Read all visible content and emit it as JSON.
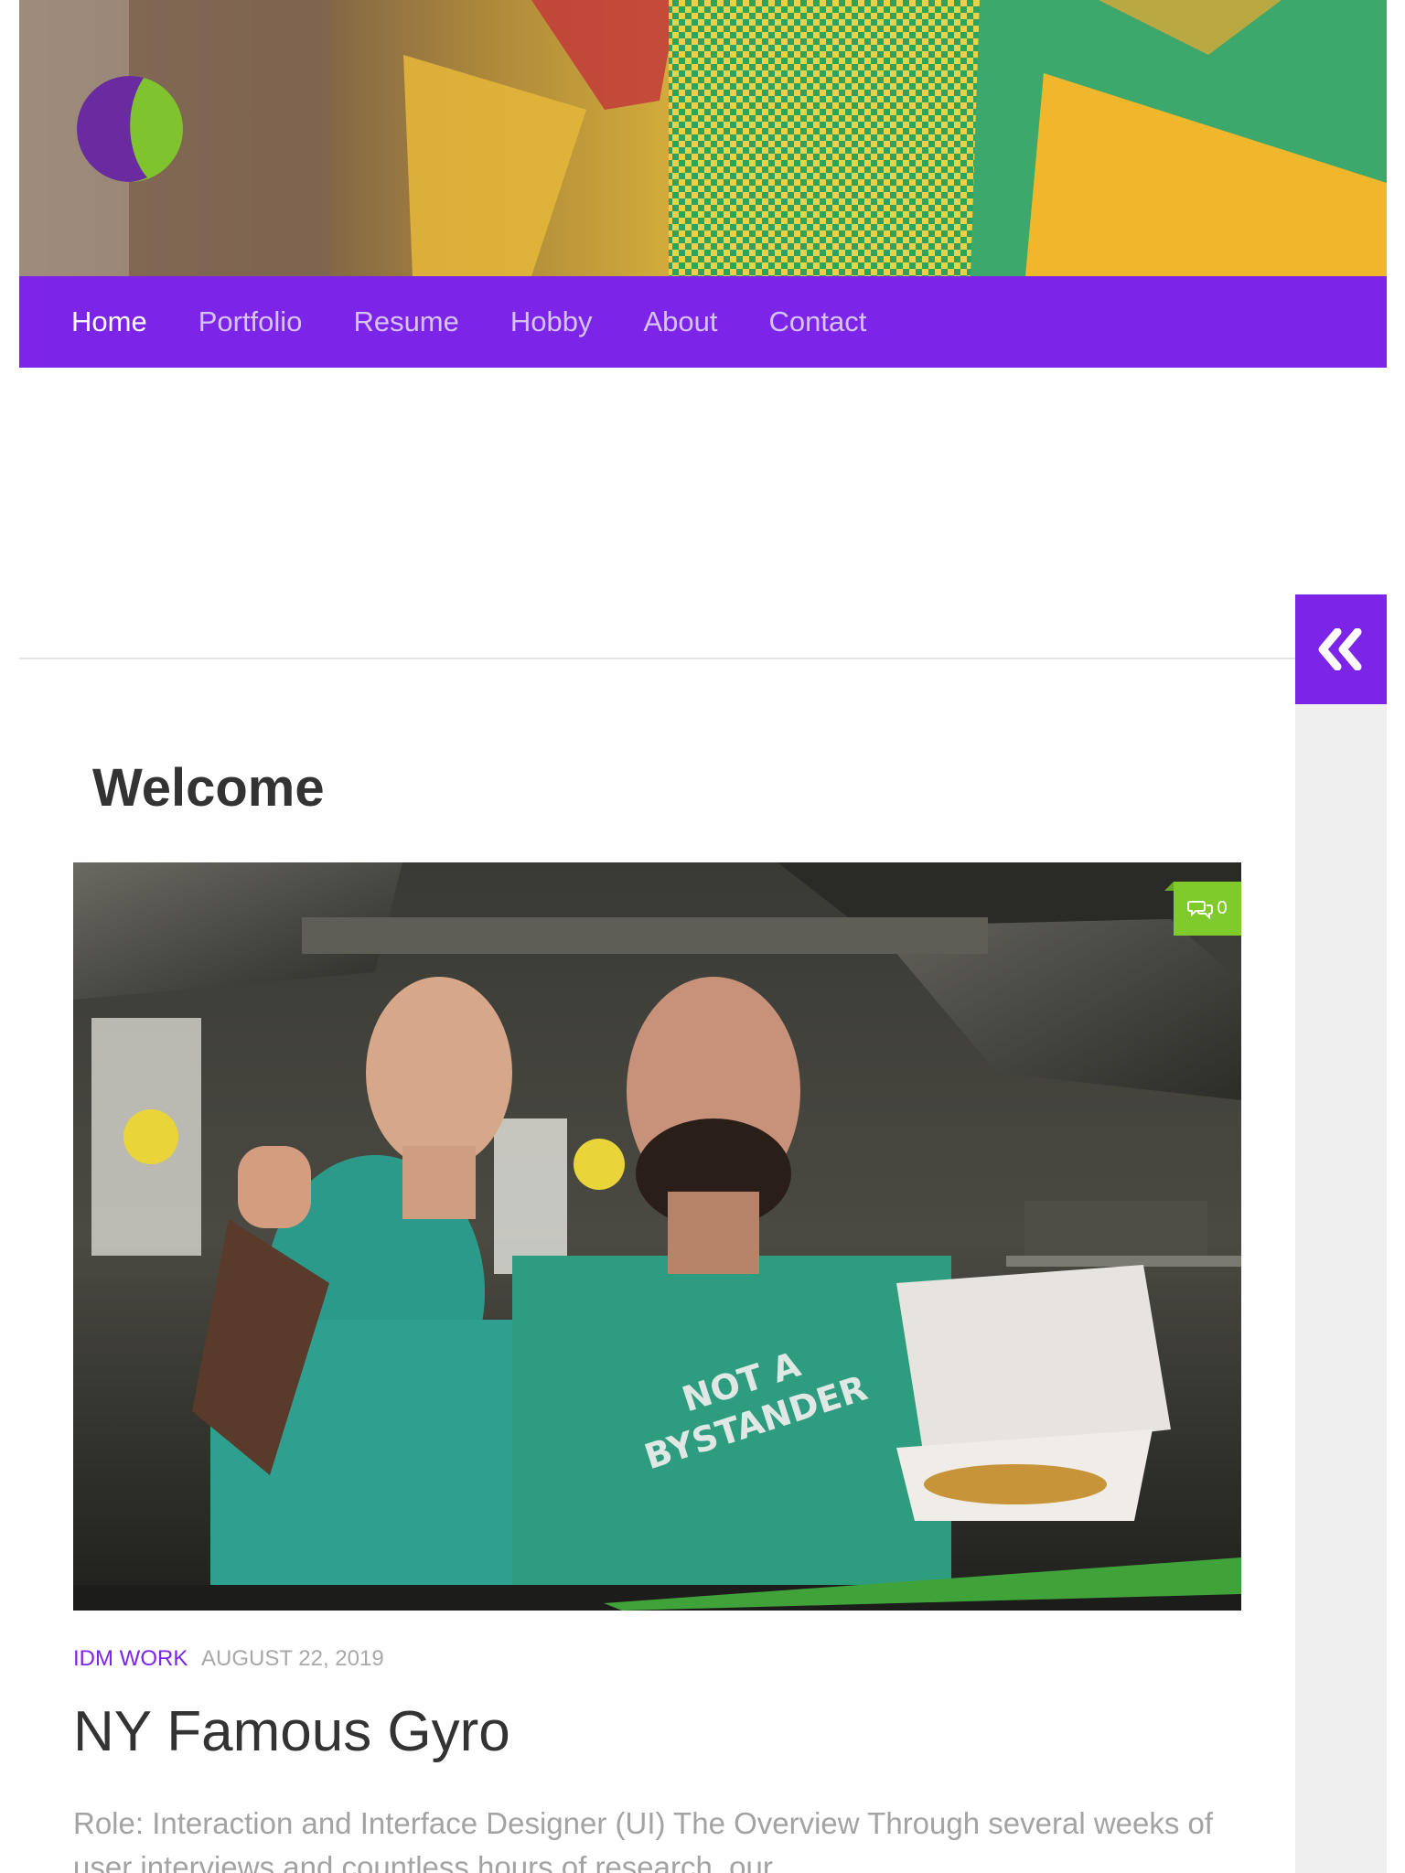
{
  "site": {
    "logo_icon": "crescent-logo",
    "colors": {
      "accent": "#7c24e8",
      "badge": "#7fcb2b",
      "text_dark": "#333333",
      "text_muted": "#a3a3a3"
    }
  },
  "nav": {
    "items": [
      {
        "label": "Home",
        "active": true
      },
      {
        "label": "Portfolio",
        "active": false
      },
      {
        "label": "Resume",
        "active": false
      },
      {
        "label": "Hobby",
        "active": false
      },
      {
        "label": "About",
        "active": false
      },
      {
        "label": "Contact",
        "active": false
      }
    ]
  },
  "sidebar": {
    "toggle_icon": "double-chevron-left-icon"
  },
  "page": {
    "title": "Welcome"
  },
  "post": {
    "comments_icon": "comment-bubbles-icon",
    "comments_count": "0",
    "category": "IDM WORK",
    "date": "AUGUST 22, 2019",
    "title": "NY Famous Gyro",
    "excerpt": "Role: Interaction and Interface Designer (UI) The Overview Through several weeks of user interviews and countless hours of research, our"
  }
}
